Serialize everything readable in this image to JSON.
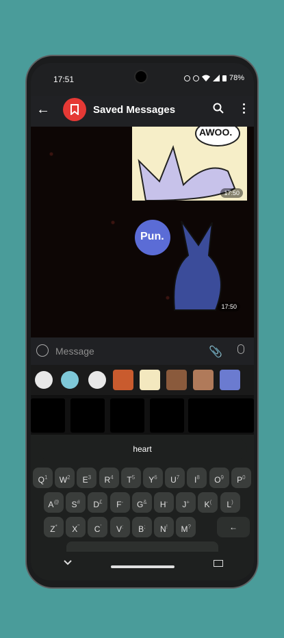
{
  "status": {
    "time": "17:51",
    "battery": "78%"
  },
  "appbar": {
    "title": "Saved Messages"
  },
  "messages": [
    {
      "text": "AWOO.",
      "time": "17:50"
    },
    {
      "text": "Pun.",
      "time": "17:50"
    }
  ],
  "input": {
    "placeholder": "Message"
  },
  "keyboard": {
    "suggestion": "heart",
    "row1": [
      {
        "k": "Q",
        "s": "1"
      },
      {
        "k": "W",
        "s": "2"
      },
      {
        "k": "E",
        "s": "3"
      },
      {
        "k": "R",
        "s": "4"
      },
      {
        "k": "T",
        "s": "5"
      },
      {
        "k": "Y",
        "s": "6"
      },
      {
        "k": "U",
        "s": "7"
      },
      {
        "k": "I",
        "s": "8"
      },
      {
        "k": "O",
        "s": "9"
      },
      {
        "k": "P",
        "s": "0"
      }
    ],
    "row2": [
      {
        "k": "A",
        "s": "@"
      },
      {
        "k": "S",
        "s": "#"
      },
      {
        "k": "D",
        "s": "£"
      },
      {
        "k": "F",
        "s": "-"
      },
      {
        "k": "G",
        "s": "&"
      },
      {
        "k": "H",
        "s": "-"
      },
      {
        "k": "J",
        "s": "+"
      },
      {
        "k": "K",
        "s": "("
      },
      {
        "k": "L",
        "s": ")"
      }
    ],
    "row3": [
      {
        "k": "Z",
        "s": "*"
      },
      {
        "k": "X",
        "s": "\""
      },
      {
        "k": "C",
        "s": "'"
      },
      {
        "k": "V",
        "s": ":"
      },
      {
        "k": "B",
        "s": ";"
      },
      {
        "k": "N",
        "s": "!"
      },
      {
        "k": "M",
        "s": "?"
      }
    ],
    "backspace": "←"
  },
  "colors": {
    "accent": "#e53935",
    "background": "#4a9c9a"
  }
}
